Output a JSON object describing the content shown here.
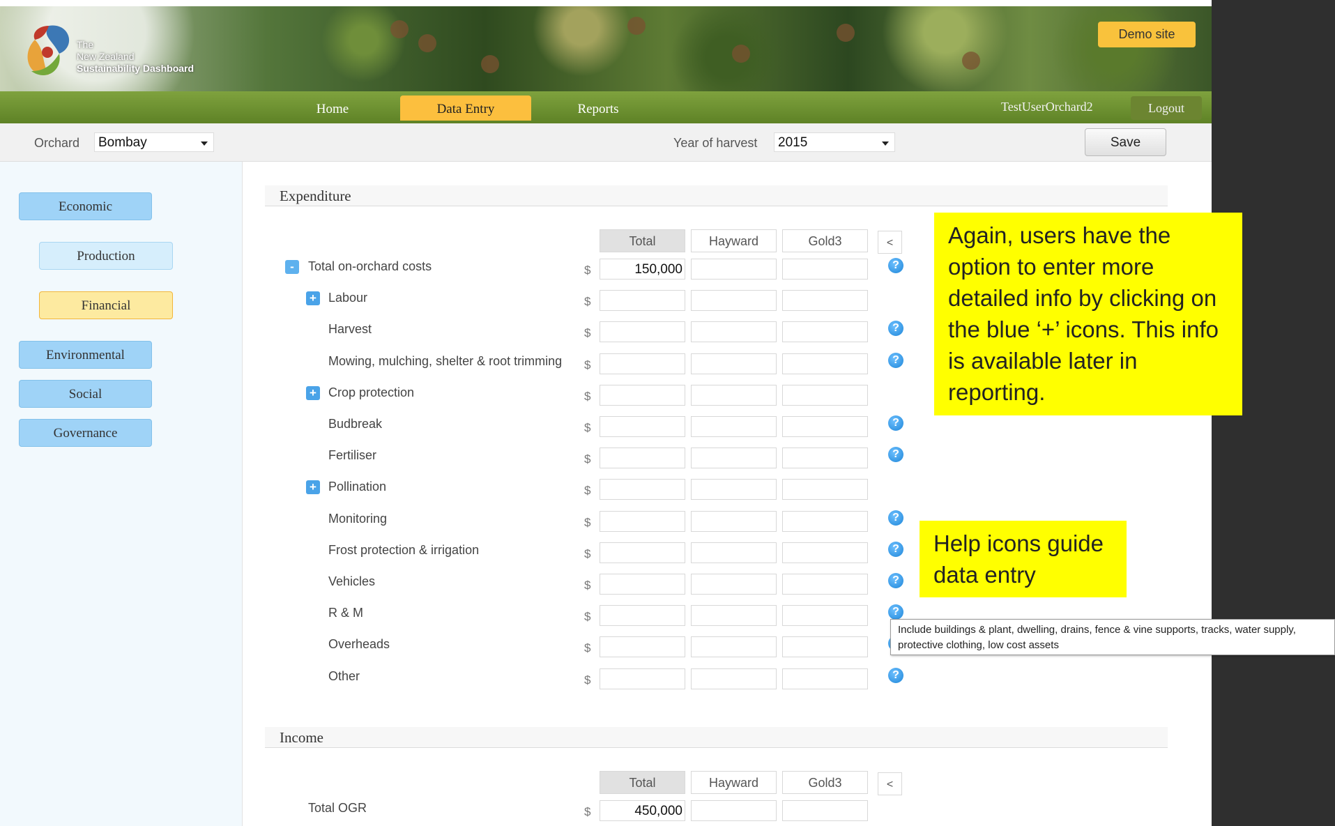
{
  "header": {
    "logo_lines": [
      "The",
      "New Zealand",
      "Sustainability Dashboard"
    ],
    "demo_label": "Demo site"
  },
  "nav": {
    "items": [
      "Home",
      "Data Entry",
      "Reports"
    ],
    "active": "Data Entry",
    "user": "TestUserOrchard2",
    "logout": "Logout"
  },
  "filters": {
    "orchard_label": "Orchard",
    "orchard_value": "Bombay",
    "year_label": "Year of harvest",
    "year_value": "2015",
    "save_label": "Save"
  },
  "sidebar": {
    "items": [
      {
        "label": "Economic",
        "style": "blue"
      },
      {
        "label": "Production",
        "style": "light"
      },
      {
        "label": "Financial",
        "style": "yellow"
      },
      {
        "label": "Environmental",
        "style": "blue"
      },
      {
        "label": "Social",
        "style": "blue"
      },
      {
        "label": "Governance",
        "style": "blue"
      }
    ]
  },
  "expenditure": {
    "title": "Expenditure",
    "columns": [
      "Total",
      "Hayward",
      "Gold3"
    ],
    "collapse": "<",
    "currency": "$",
    "rows": [
      {
        "label": "Total on-orchard costs",
        "toggle": "-",
        "total": "150,000",
        "help": true
      },
      {
        "label": "Labour",
        "toggle": "+",
        "total": "",
        "help": false
      },
      {
        "label": "Harvest",
        "toggle": "",
        "total": "",
        "help": true
      },
      {
        "label": "Mowing, mulching, shelter & root trimming",
        "toggle": "",
        "total": "",
        "help": true
      },
      {
        "label": "Crop protection",
        "toggle": "+",
        "total": "",
        "help": false
      },
      {
        "label": "Budbreak",
        "toggle": "",
        "total": "",
        "help": true
      },
      {
        "label": "Fertiliser",
        "toggle": "",
        "total": "",
        "help": true
      },
      {
        "label": "Pollination",
        "toggle": "+",
        "total": "",
        "help": false
      },
      {
        "label": "Monitoring",
        "toggle": "",
        "total": "",
        "help": true
      },
      {
        "label": "Frost protection & irrigation",
        "toggle": "",
        "total": "",
        "help": true
      },
      {
        "label": "Vehicles",
        "toggle": "",
        "total": "",
        "help": true
      },
      {
        "label": "R & M",
        "toggle": "",
        "total": "",
        "help": true
      },
      {
        "label": "Overheads",
        "toggle": "",
        "total": "",
        "help": true
      },
      {
        "label": "Other",
        "toggle": "",
        "total": "",
        "help": true
      }
    ],
    "help_glyph": "?"
  },
  "income": {
    "title": "Income",
    "columns": [
      "Total",
      "Hayward",
      "Gold3"
    ],
    "collapse": "<",
    "currency": "$",
    "rows": [
      {
        "label": "Total OGR",
        "total": "450,000"
      }
    ]
  },
  "annotations": {
    "plus_note": "Again, users have the option to enter more detailed info by clicking on the blue ‘+’ icons.  This info is available later in reporting.",
    "help_note": "Help icons guide data entry",
    "tooltip": "Include buildings & plant, dwelling, drains, fence & vine supports, tracks, water supply, protective clothing, low cost assets"
  },
  "colors": {
    "nav_green": "#6b8f2f",
    "active_tab": "#fcbf3e",
    "sidebar_blue": "#9fd3f7",
    "help_blue": "#1e86d8",
    "note_yellow": "#ffff00"
  }
}
